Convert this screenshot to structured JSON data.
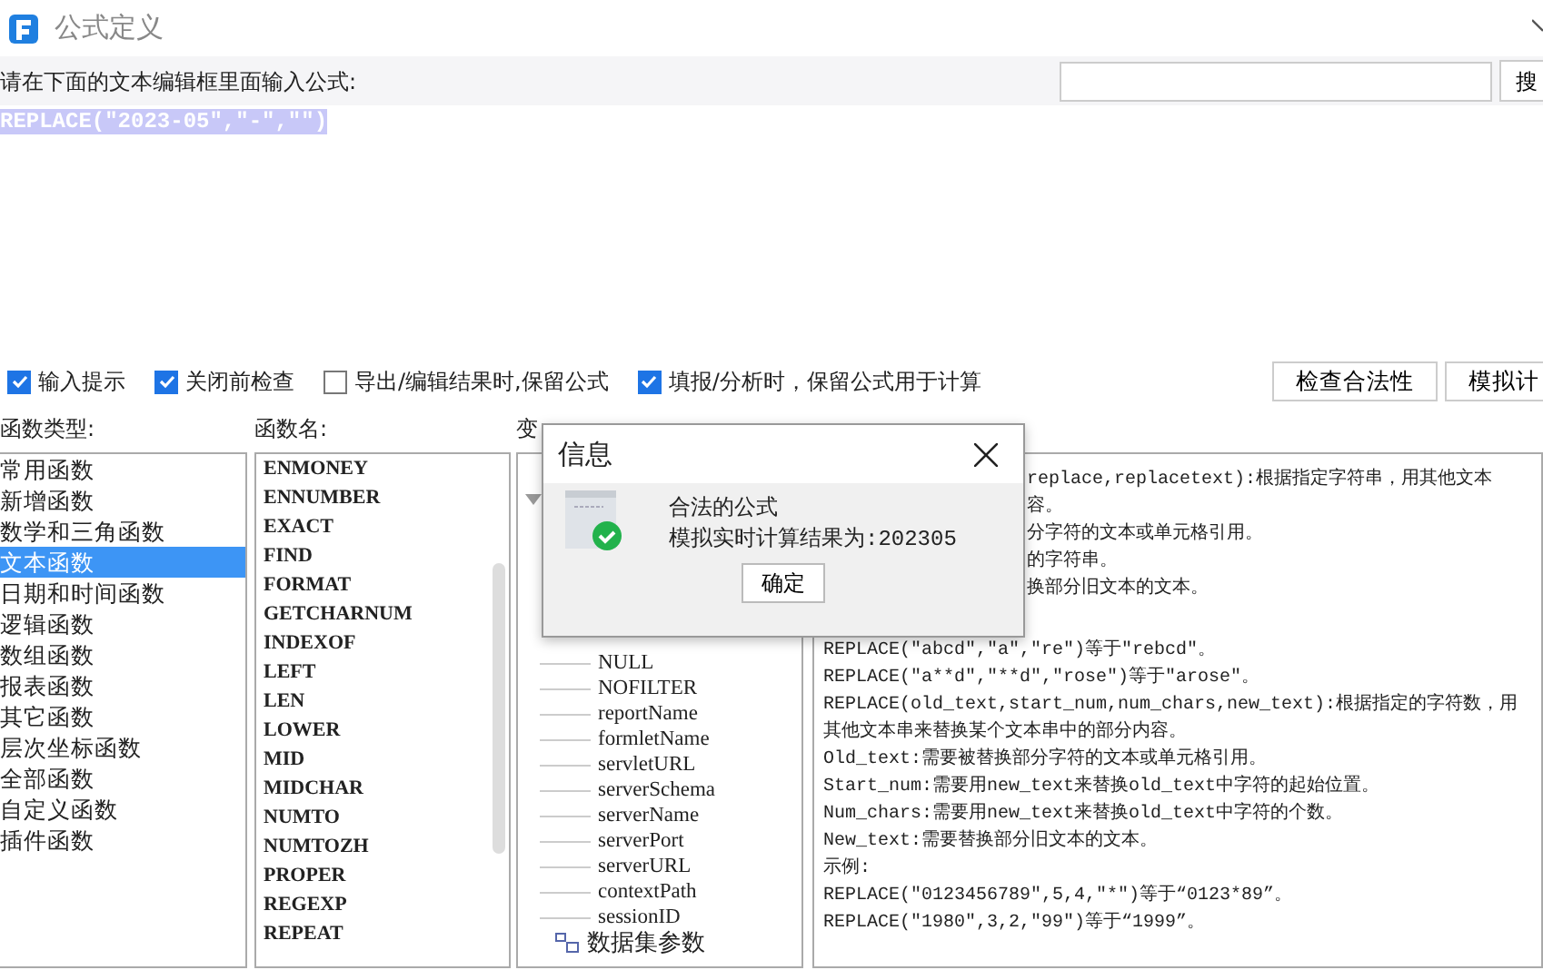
{
  "window": {
    "title": "公式定义"
  },
  "prompt": {
    "label": "请在下面的文本编辑框里面输入公式:",
    "search_button": "搜"
  },
  "editor": {
    "text": "REPLACE(\"2023-05\",\"-\",\"\")",
    "selected": true
  },
  "options": [
    {
      "label": "输入提示",
      "checked": true
    },
    {
      "label": "关闭前检查",
      "checked": true
    },
    {
      "label": "导出/编辑结果时,保留公式",
      "checked": false
    },
    {
      "label": "填报/分析时，保留公式用于计算",
      "checked": true
    }
  ],
  "buttons": [
    "检查合法性",
    "模拟计"
  ],
  "function_types": {
    "heading": "函数类型:",
    "items": [
      {
        "label": "常用函数",
        "selected": false
      },
      {
        "label": "新增函数",
        "selected": false
      },
      {
        "label": "数学和三角函数",
        "selected": false
      },
      {
        "label": "文本函数",
        "selected": true
      },
      {
        "label": "日期和时间函数",
        "selected": false
      },
      {
        "label": "逻辑函数",
        "selected": false
      },
      {
        "label": "数组函数",
        "selected": false
      },
      {
        "label": "报表函数",
        "selected": false
      },
      {
        "label": "其它函数",
        "selected": false
      },
      {
        "label": "层次坐标函数",
        "selected": false
      },
      {
        "label": "全部函数",
        "selected": false
      },
      {
        "label": "自定义函数",
        "selected": false
      },
      {
        "label": "插件函数",
        "selected": false
      }
    ]
  },
  "function_names": {
    "heading": "函数名:",
    "items": [
      "ENMONEY",
      "ENNUMBER",
      "EXACT",
      "FIND",
      "FORMAT",
      "GETCHARNUM",
      "INDEXOF",
      "LEFT",
      "LEN",
      "LOWER",
      "MID",
      "MIDCHAR",
      "NUMTO",
      "NUMTOZH",
      "PROPER",
      "REGEXP",
      "REPEAT"
    ]
  },
  "variables": {
    "heading": "变",
    "tree": [
      {
        "expanded": true,
        "children": [
          {
            "label": "NULL"
          },
          {
            "label": "NOFILTER"
          },
          {
            "label": "reportName"
          },
          {
            "label": "formletName"
          },
          {
            "label": "servletURL"
          },
          {
            "label": "serverSchema"
          },
          {
            "label": "serverName"
          },
          {
            "label": "serverPort"
          },
          {
            "label": "serverURL"
          },
          {
            "label": "contextPath"
          },
          {
            "label": "sessionID"
          }
        ]
      },
      {
        "label": "数据集参数"
      }
    ]
  },
  "help": {
    "lines": [
      {
        "text": "replace,replacetext):根据指定字符串，用其他文本",
        "partly_hidden": true
      },
      {
        "text": "容。",
        "partly_hidden": true
      },
      {
        "text": "分字符的文本或单元格引用。",
        "partly_hidden": true
      },
      {
        "text": "的字符串。",
        "partly_hidden": true
      },
      {
        "text": "换部分旧文本的文本。",
        "partly_hidden": true
      },
      {
        "text": "REPLACE(\"abcd\",\"a\",\"re\")等于\"rebcd\"。",
        "gap_before": true
      },
      {
        "text": "REPLACE(\"a**d\",\"**d\",\"rose\")等于\"arose\"。"
      },
      {
        "text": "REPLACE(old_text,start_num,num_chars,new_text):根据指定的字符数，用"
      },
      {
        "text": "其他文本串来替换某个文本串中的部分内容。"
      },
      {
        "text": "Old_text:需要被替换部分字符的文本或单元格引用。"
      },
      {
        "text": "Start_num:需要用new_text来替换old_text中字符的起始位置。"
      },
      {
        "text": "Num_chars:需要用new_text来替换old_text中字符的个数。"
      },
      {
        "text": "New_text:需要替换部分旧文本的文本。"
      },
      {
        "text": "示例:"
      },
      {
        "text": "REPLACE(\"0123456789\",5,4,\"*\")等于“0123*89”。"
      },
      {
        "text": "REPLACE(\"1980\",3,2,\"99\")等于“1999”。"
      }
    ]
  },
  "dialog": {
    "title": "信息",
    "message": "合法的公式",
    "result": "模拟实时计算结果为:202305",
    "ok_button": "确定"
  }
}
